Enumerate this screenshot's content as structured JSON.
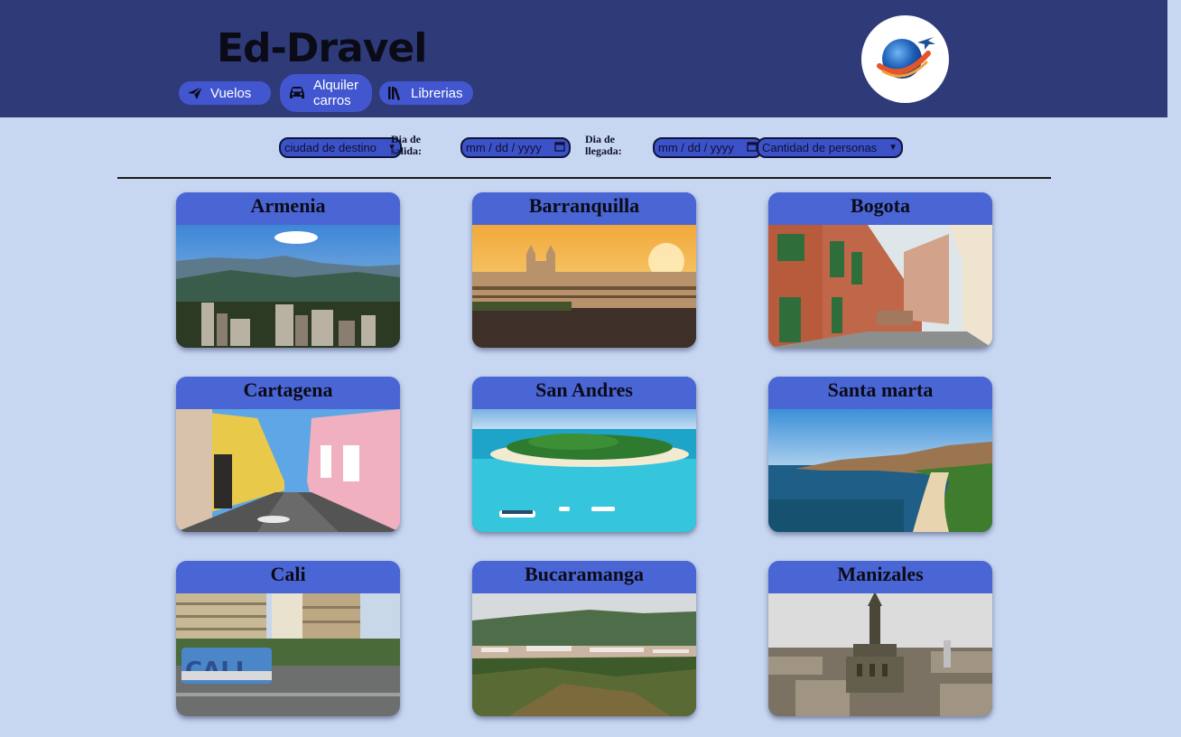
{
  "header": {
    "brand": "Ed-Dravel",
    "nav": [
      {
        "label": "Vuelos",
        "icon": "plane-icon"
      },
      {
        "label": "Alquiler carros",
        "icon": "car-icon"
      },
      {
        "label": "Librerias",
        "icon": "books-icon"
      }
    ],
    "logo_icon": "globe-plane-icon"
  },
  "search": {
    "destination_selected": "ciudad de destino",
    "salida_label": "Dia de salida:",
    "salida_value": "mm / dd / yyyy",
    "llegada_label": "Dia de llegada:",
    "llegada_value": "mm / dd / yyyy",
    "people_selected": "Cantidad de personas"
  },
  "cities": [
    {
      "name": "Armenia",
      "image": "mountain-city-photo"
    },
    {
      "name": "Barranquilla",
      "image": "cathedral-sunset-photo"
    },
    {
      "name": "Bogota",
      "image": "colonial-street-photo"
    },
    {
      "name": "Cartagena",
      "image": "colorful-street-photo"
    },
    {
      "name": "San Andres",
      "image": "island-sea-photo"
    },
    {
      "name": "Santa marta",
      "image": "bay-coast-photo"
    },
    {
      "name": "Cali",
      "image": "cali-sign-photo"
    },
    {
      "name": "Bucaramanga",
      "image": "valley-city-photo"
    },
    {
      "name": "Manizales",
      "image": "cathedral-city-photo"
    }
  ],
  "colors": {
    "header_bg": "#2f3a78",
    "page_bg": "#c7d6f1",
    "accent": "#4a66d4"
  }
}
